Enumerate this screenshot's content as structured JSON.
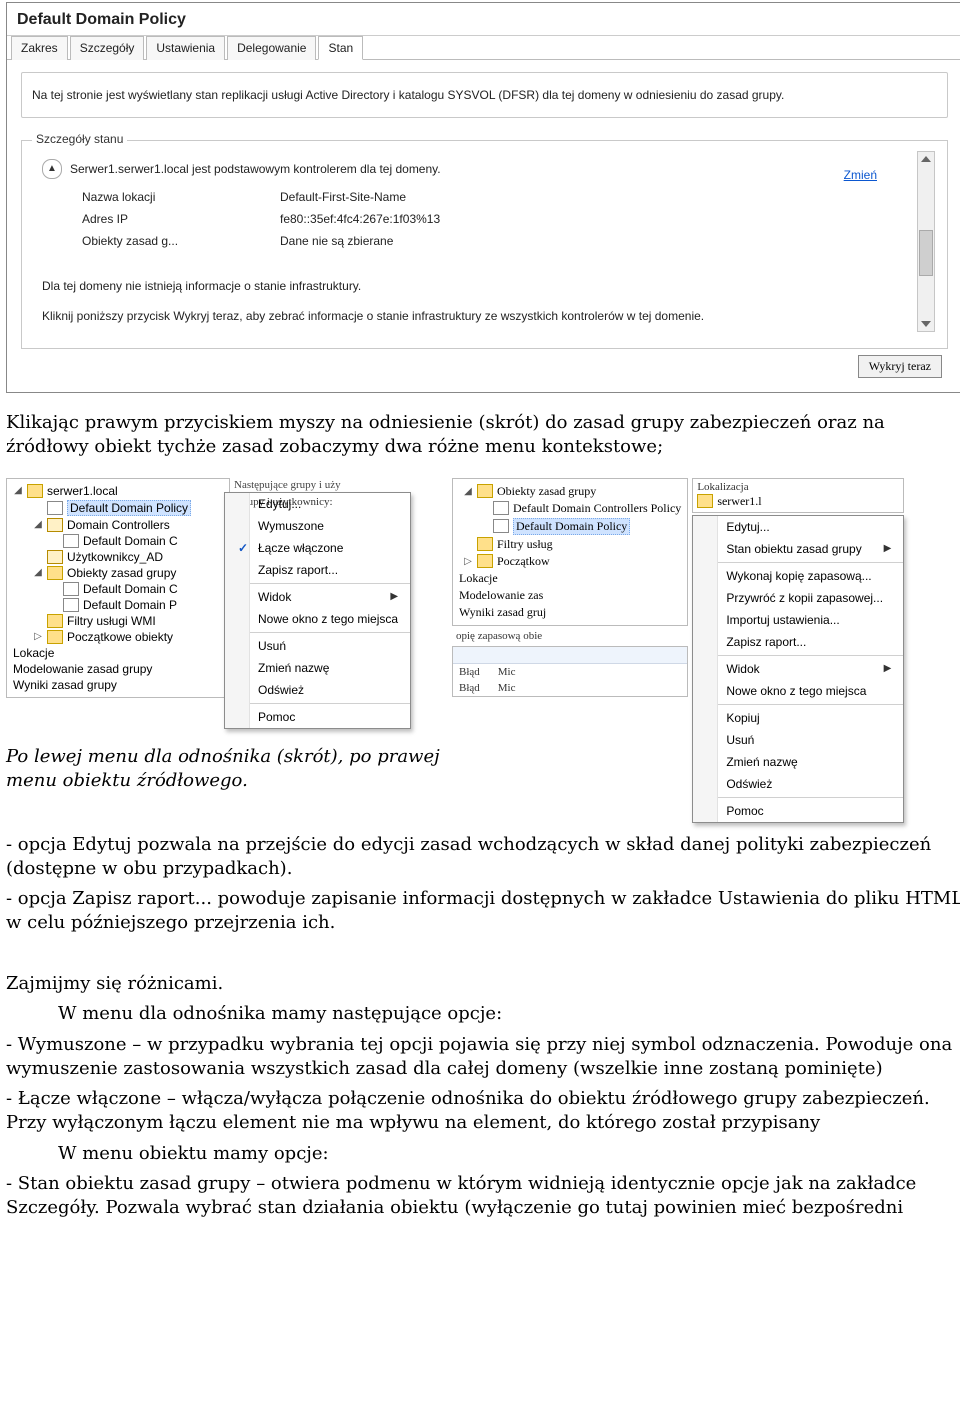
{
  "panel": {
    "title": "Default Domain Policy",
    "tabs": [
      "Zakres",
      "Szczegóły",
      "Ustawienia",
      "Delegowanie",
      "Stan"
    ],
    "activeTab": 4,
    "description": "Na tej stronie jest wyświetlany stan replikacji usługi Active Directory i katalogu SYSVOL (DFSR) dla tej domeny w odniesieniu do zasad grupy.",
    "groupLegend": "Szczegóły stanu",
    "dcLine": "Serwer1.serwer1.local jest podstawowym kontrolerem dla tej domeny.",
    "changeLink": "Zmień",
    "kv": [
      {
        "k": "Nazwa lokacji",
        "v": "Default-First-Site-Name"
      },
      {
        "k": "Adres IP",
        "v": "fe80::35ef:4fc4:267e:1f03%13"
      },
      {
        "k": "Obiekty zasad g...",
        "v": "Dane nie są zbierane"
      }
    ],
    "infraMissing": "Dla tej domeny nie istnieją informacje o stanie infrastruktury.",
    "infraHint": "Kliknij poniższy przycisk Wykryj teraz, aby zebrać informacje o stanie infrastruktury ze wszystkich kontrolerów w tej domenie.",
    "detectBtn": "Wykryj teraz"
  },
  "para1": "Klikając prawym przyciskiem myszy na odniesienie (skrót) do zasad grupy zabezpieczeń oraz na źródłowy obiekt tychże zasad zobaczymy dwa różne menu kontekstowe;",
  "leftTree": {
    "root": "serwer1.local",
    "items": [
      {
        "depth": 1,
        "caret": "",
        "icon": "gpo",
        "label": "Default Domain Policy",
        "selected": true
      },
      {
        "depth": 1,
        "caret": "◢",
        "icon": "ou",
        "label": "Domain Controllers"
      },
      {
        "depth": 2,
        "caret": "",
        "icon": "gpo",
        "label": "Default Domain C"
      },
      {
        "depth": 1,
        "caret": "",
        "icon": "ou",
        "label": "Użytkownikcy_AD"
      },
      {
        "depth": 1,
        "caret": "◢",
        "icon": "folder",
        "label": "Obiekty zasad grupy"
      },
      {
        "depth": 2,
        "caret": "",
        "icon": "gpo",
        "label": "Default Domain C"
      },
      {
        "depth": 2,
        "caret": "",
        "icon": "gpo",
        "label": "Default Domain P"
      },
      {
        "depth": 1,
        "caret": "",
        "icon": "folder",
        "label": "Filtry usługi WMI"
      },
      {
        "depth": 1,
        "caret": "▷",
        "icon": "folder",
        "label": "Początkowe obiekty"
      }
    ],
    "bottomItems": [
      "Lokacje",
      "Modelowanie zasad grupy",
      "Wyniki zasad grupy"
    ]
  },
  "leftMenu": {
    "items": [
      {
        "label": "Edytuj..."
      },
      {
        "label": "Wymuszone"
      },
      {
        "label": "Łącze włączone",
        "checked": true
      },
      {
        "label": "Zapisz raport..."
      },
      {
        "sep": true
      },
      {
        "label": "Widok",
        "sub": true
      },
      {
        "label": "Nowe okno z tego miejsca"
      },
      {
        "sep": true
      },
      {
        "label": "Usuń"
      },
      {
        "label": "Zmień nazwę"
      },
      {
        "label": "Odśwież"
      },
      {
        "sep": true
      },
      {
        "label": "Pomoc"
      }
    ]
  },
  "midTop": "Następujące grupy i uży",
  "midLabel": "Grupy i użytkownicy:",
  "rightTree": {
    "items": [
      {
        "depth": 0,
        "caret": "◢",
        "icon": "folder",
        "label": "Obiekty zasad grupy"
      },
      {
        "depth": 1,
        "caret": "",
        "icon": "gpo",
        "label": "Default Domain Controllers Policy"
      },
      {
        "depth": 1,
        "caret": "",
        "icon": "gpo",
        "label": "Default Domain Policy",
        "selected": true
      },
      {
        "depth": 0,
        "caret": "",
        "icon": "folder",
        "label": "Filtry usług"
      },
      {
        "depth": 0,
        "caret": "▷",
        "icon": "folder",
        "label": "Początkow"
      }
    ],
    "bottomItems": [
      "Lokacje",
      "Modelowanie zas",
      "Wyniki zasad gruj"
    ]
  },
  "rightLoc": {
    "header": "Lokalizacja",
    "value": "serwer1.l"
  },
  "rightMenu": {
    "items": [
      {
        "label": "Edytuj..."
      },
      {
        "label": "Stan obiektu zasad grupy",
        "sub": true
      },
      {
        "sep": true
      },
      {
        "label": "Wykonaj kopię zapasową..."
      },
      {
        "label": "Przywróć z kopii zapasowej..."
      },
      {
        "label": "Importuj ustawienia..."
      },
      {
        "label": "Zapisz raport..."
      },
      {
        "sep": true
      },
      {
        "label": "Widok",
        "sub": true
      },
      {
        "label": "Nowe okno z tego miejsca"
      },
      {
        "sep": true
      },
      {
        "label": "Kopiuj"
      },
      {
        "label": "Usuń"
      },
      {
        "label": "Zmień nazwę"
      },
      {
        "label": "Odśwież"
      },
      {
        "sep": true
      },
      {
        "label": "Pomoc"
      }
    ]
  },
  "backupLabel": "opię zapasową obie",
  "results": {
    "rows": [
      [
        "Błąd",
        "Mic"
      ],
      [
        "Błąd",
        "Mic"
      ]
    ]
  },
  "caption": "Po lewej menu dla odnośnika (skrót), po prawej menu obiektu źródłowego.",
  "bodyText": [
    "- opcja Edytuj pozwala na przejście do edycji zasad wchodzących w skład danej polityki zabezpieczeń (dostępne w obu przypadkach).",
    "- opcja Zapisz raport... powoduje zapisanie informacji dostępnych w zakładce Ustawienia do pliku HTML w celu późniejszego przejrzenia ich.",
    "",
    "Zajmijmy się różnicami.",
    {
      "indent": true,
      "text": "W menu dla odnośnika mamy następujące opcje:"
    },
    "-  Wymuszone – w przypadku wybrania tej opcji pojawia się przy niej symbol odznaczenia. Powoduje ona wymuszenie zastosowania wszystkich zasad dla całej domeny (wszelkie inne zostaną pominięte)",
    "- Łącze włączone – włącza/wyłącza połączenie odnośnika do obiektu źródłowego grupy zabezpieczeń. Przy wyłączonym łączu element nie ma wpływu na element, do którego został przypisany",
    {
      "indent": true,
      "text": "W menu obiektu mamy opcje:"
    },
    "- Stan obiektu zasad grupy – otwiera podmenu w którym widnieją identycznie opcje jak na zakładce Szczegóły. Pozwala wybrać stan działania obiektu (wyłączenie go tutaj powinien mieć bezpośredni"
  ]
}
